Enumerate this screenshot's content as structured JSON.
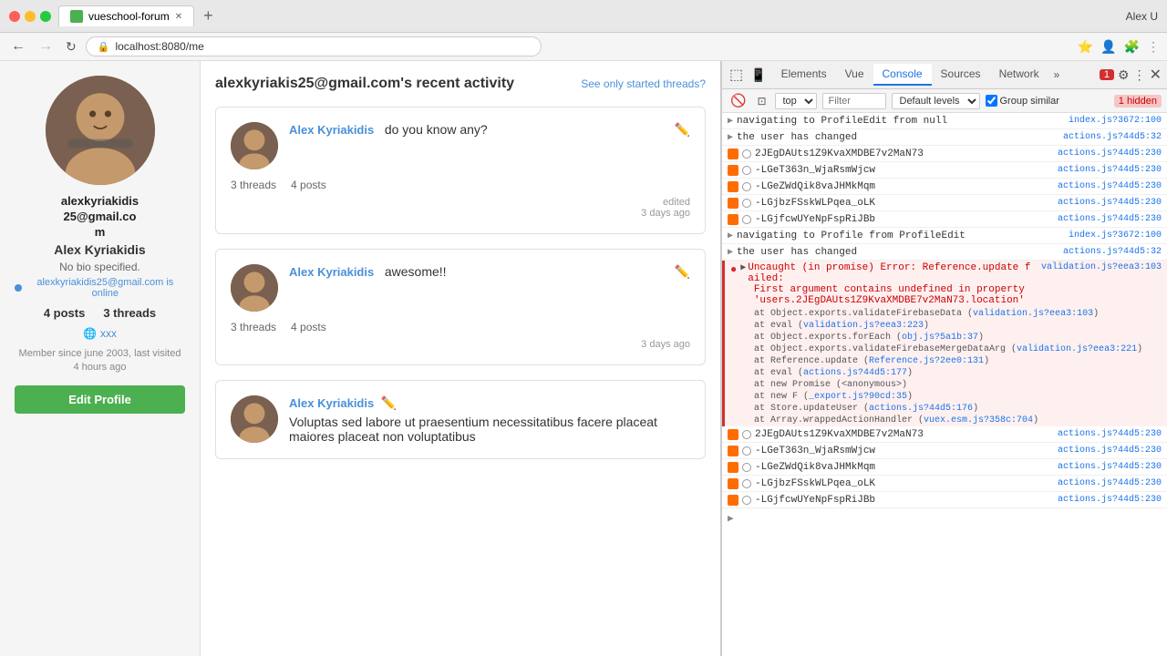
{
  "browser": {
    "tab_title": "vueschool-forum",
    "address": "localhost:8080/me",
    "user_chrome": "Alex U"
  },
  "devtools": {
    "tabs": [
      "Elements",
      "Vue",
      "Console",
      "Sources",
      "Network"
    ],
    "active_tab": "Console",
    "error_count": "1",
    "hidden_count": "1 hidden",
    "filter_placeholder": "Filter",
    "log_level": "Default levels",
    "top_label": "top",
    "group_similar": "Group similar",
    "console_entries": [
      {
        "type": "log",
        "icon": "arrow",
        "msg": "navigating to ProfileEdit from null",
        "source": "index.js?3672:100"
      },
      {
        "type": "log",
        "icon": "arrow",
        "msg": "the user has changed",
        "source": "actions.js?44d5:32"
      },
      {
        "type": "firebase",
        "icon": "firebase",
        "msg": "2JEgDAUts1Z9KvaXMDBE7v2MaN73",
        "source": "actions.js?44d5:230"
      },
      {
        "type": "firebase",
        "icon": "firebase",
        "msg": "-LGeT363n_WjaRsmWjcw",
        "source": "actions.js?44d5:230"
      },
      {
        "type": "firebase",
        "icon": "firebase",
        "msg": "-LGeZWdQik8vaJHMkMqm",
        "source": "actions.js?44d5:230"
      },
      {
        "type": "firebase",
        "icon": "firebase",
        "msg": "-LGjbzFSskWLPqea_oLK",
        "source": "actions.js?44d5:230"
      },
      {
        "type": "firebase",
        "icon": "firebase",
        "msg": "-LGjfcwUYeNpFspRiJBb",
        "source": "actions.js?44d5:230"
      },
      {
        "type": "log",
        "icon": "arrow",
        "msg": "navigating to Profile from ProfileEdit",
        "source": "index.js?3672:100"
      },
      {
        "type": "log",
        "icon": "arrow",
        "msg": "the user has changed",
        "source": "actions.js?44d5:32"
      },
      {
        "type": "error",
        "icon": "error",
        "expanded": true,
        "msg": "Uncaught (in promise) Error: Reference.update failed: First argument contains undefined in property 'users.2JEgDAUts1Z9KvaXMDBE7v2MaN73.location'",
        "source": "validation.js?eea3:103"
      },
      {
        "type": "error_detail",
        "msg": "at Object.exports.validateFirebaseData (validation.js?eea3:103)"
      },
      {
        "type": "error_stack",
        "msg": "at eval (validation.js?eea3:223)"
      },
      {
        "type": "error_stack",
        "msg": "at Object.exports.forEach (obj.js?5a1b:37)"
      },
      {
        "type": "error_stack",
        "msg": "at Object.exports.validateFirebaseMergeDataArg (validation.js?eea3:221)"
      },
      {
        "type": "error_stack",
        "msg": "at Reference.update (Reference.js?2ee0:131)"
      },
      {
        "type": "error_stack",
        "msg": "at eval (actions.js?44d5:177)"
      },
      {
        "type": "error_stack",
        "msg": "at new Promise (<anonymous>)"
      },
      {
        "type": "error_stack",
        "msg": "at new F (_export.js?90cd:35)"
      },
      {
        "type": "error_stack",
        "msg": "at Store.updateUser (actions.js?44d5:176)"
      },
      {
        "type": "error_stack",
        "msg": "at Array.wrappedActionHandler (vuex.esm.js?358c:704)"
      },
      {
        "type": "firebase",
        "icon": "firebase",
        "msg": "2JEgDAUts1Z9KvaXMDBE7v2MaN73",
        "source": "actions.js?44d5:230"
      },
      {
        "type": "firebase",
        "icon": "firebase",
        "msg": "-LGeT363n_WjaRsmWjcw",
        "source": "actions.js?44d5:230"
      },
      {
        "type": "firebase",
        "icon": "firebase",
        "msg": "-LGeZWdQik8vaJHMkMqm",
        "source": "actions.js?44d5:230"
      },
      {
        "type": "firebase",
        "icon": "firebase",
        "msg": "-LGjbzFSskWLPqea_oLK",
        "source": "actions.js?44d5:230"
      },
      {
        "type": "firebase",
        "icon": "firebase",
        "msg": "-LGjfcwUYeNpFspRiJBb",
        "source": "actions.js?44d5:230"
      }
    ]
  },
  "profile": {
    "username": "alexkyriakidis25@gmail.com",
    "display_name": "Alex Kyriakidis",
    "email_display": "alexkyriakidis25@gmail.co m",
    "bio": "No bio specified.",
    "online_text": "alexkyriakidis25@gmail.com is online",
    "posts_count": "4 posts",
    "threads_count": "3 threads",
    "link": "xxx",
    "member_since": "Member since june 2003, last visited 4 hours ago",
    "edit_btn": "Edit Profile"
  },
  "content": {
    "title": "alexkyriakis25@gmail.com's recent activity",
    "see_only_link": "See only started threads?",
    "posts": [
      {
        "author": "Alex Kyriakidis",
        "content": "do you know any?",
        "threads": "3 threads",
        "post_count": "4 posts",
        "timestamp": "edited\n3 days ago"
      },
      {
        "author": "Alex Kyriakidis",
        "content": "awesome!!",
        "threads": "3 threads",
        "post_count": "4 posts",
        "timestamp": "3 days ago"
      },
      {
        "author": "Alex Kyriakidis",
        "content": "Voluptas sed labore ut praesentium necessitatibus facere placeat maiores placeat non voluptatibus",
        "threads": "",
        "post_count": "",
        "timestamp": ""
      }
    ]
  }
}
